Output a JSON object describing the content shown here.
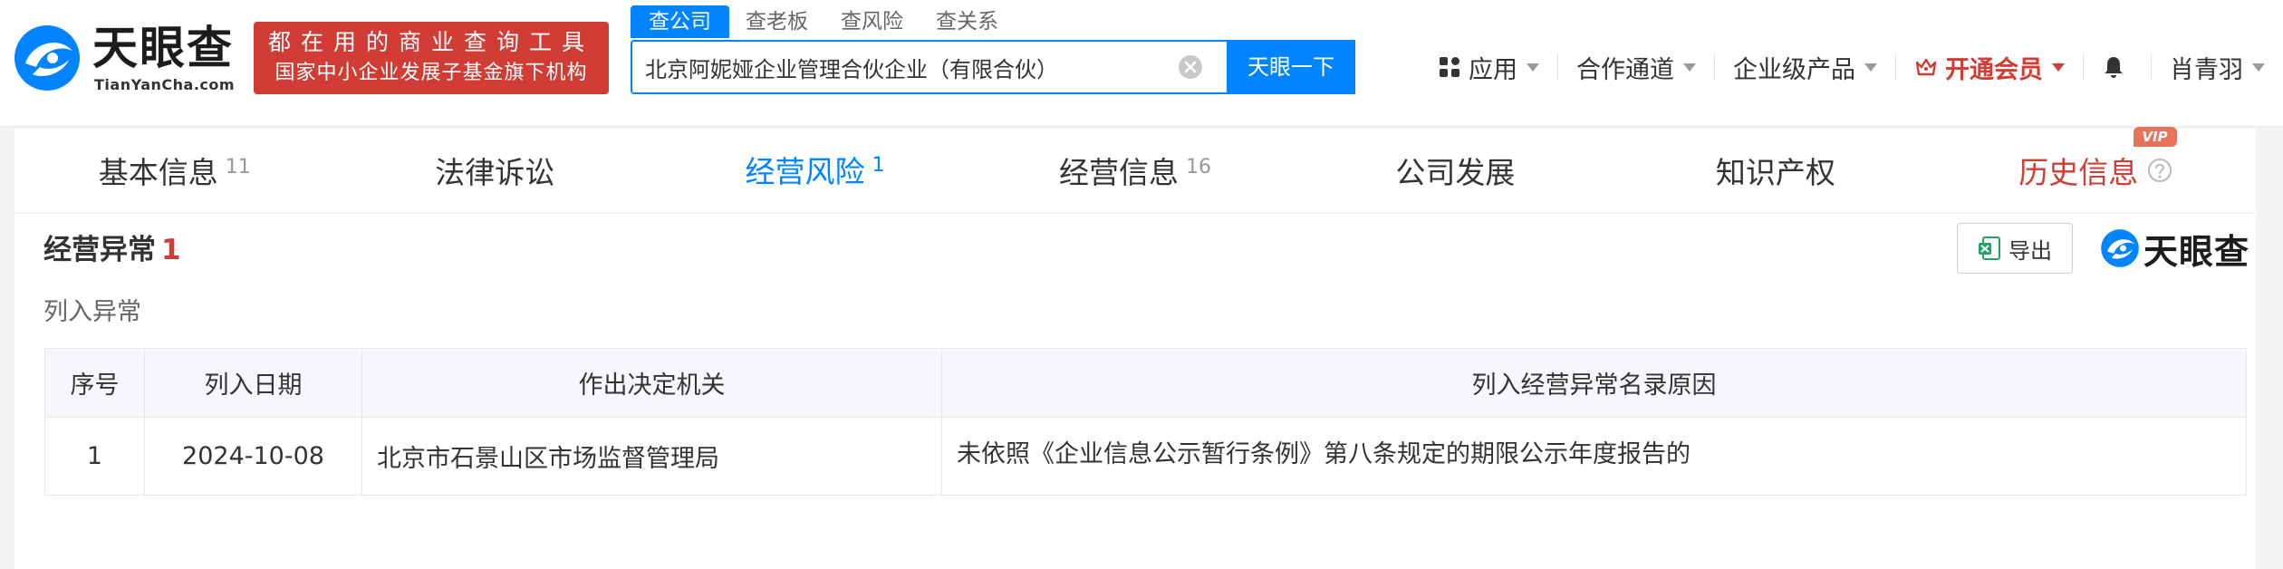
{
  "header": {
    "logo_text": "天眼查",
    "logo_sub": "TianYanCha.com",
    "slogan_line1": "都在用的商业查询工具",
    "slogan_line2": "国家中小企业发展子基金旗下机构",
    "search_tabs": [
      "查公司",
      "查老板",
      "查风险",
      "查关系"
    ],
    "search_value": "北京阿妮娅企业管理合伙企业（有限合伙）",
    "search_button": "天眼一下",
    "nav": {
      "apps": "应用",
      "partner": "合作通道",
      "enterprise": "企业级产品",
      "vip": "开通会员",
      "user": "肖青羽"
    }
  },
  "tabs": [
    {
      "label": "基本信息",
      "count": "11"
    },
    {
      "label": "法律诉讼",
      "count": ""
    },
    {
      "label": "经营风险",
      "count": "1"
    },
    {
      "label": "经营信息",
      "count": "16"
    },
    {
      "label": "公司发展",
      "count": ""
    },
    {
      "label": "知识产权",
      "count": ""
    },
    {
      "label": "历史信息",
      "count": "",
      "badge": "VIP"
    }
  ],
  "section": {
    "title": "经营异常",
    "count": "1",
    "subtitle": "列入异常",
    "export_label": "导出",
    "brand": "天眼查"
  },
  "table": {
    "headers": [
      "序号",
      "列入日期",
      "作出决定机关",
      "列入经营异常名录原因"
    ],
    "rows": [
      [
        "1",
        "2024-10-08",
        "北京市石景山区市场监督管理局",
        "未依照《企业信息公示暂行条例》第八条规定的期限公示年度报告的"
      ]
    ]
  },
  "colors": {
    "accent": "#0084ff",
    "brand_red": "#d13c35"
  }
}
